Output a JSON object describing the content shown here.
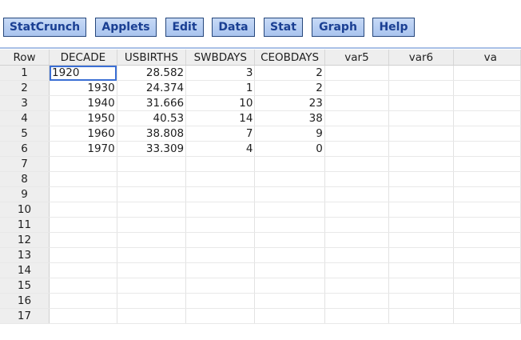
{
  "menu": [
    {
      "label": "StatCrunch"
    },
    {
      "label": "Applets"
    },
    {
      "label": "Edit"
    },
    {
      "label": "Data"
    },
    {
      "label": "Stat"
    },
    {
      "label": "Graph"
    },
    {
      "label": "Help"
    }
  ],
  "grid": {
    "corner_label": "Row",
    "columns": [
      "DECADE",
      "USBIRTHS",
      "SWBDAYS",
      "CEOBDAYS",
      "var5",
      "var6",
      "va"
    ],
    "row_numbers": [
      "1",
      "2",
      "3",
      "4",
      "5",
      "6",
      "7",
      "8",
      "9",
      "10",
      "11",
      "12",
      "13",
      "14",
      "15",
      "16",
      "17"
    ],
    "rows": [
      [
        "1920",
        "28.582",
        "3",
        "2"
      ],
      [
        "1930",
        "24.374",
        "1",
        "2"
      ],
      [
        "1940",
        "31.666",
        "10",
        "23"
      ],
      [
        "1950",
        "40.53",
        "14",
        "38"
      ],
      [
        "1960",
        "38.808",
        "7",
        "9"
      ],
      [
        "1970",
        "33.309",
        "4",
        "0"
      ]
    ]
  },
  "colors": {
    "menu_text": "#1a3f93",
    "menu_border": "#26477c",
    "selection_border": "#3b6fd4",
    "header_bg": "#eeeeee"
  }
}
